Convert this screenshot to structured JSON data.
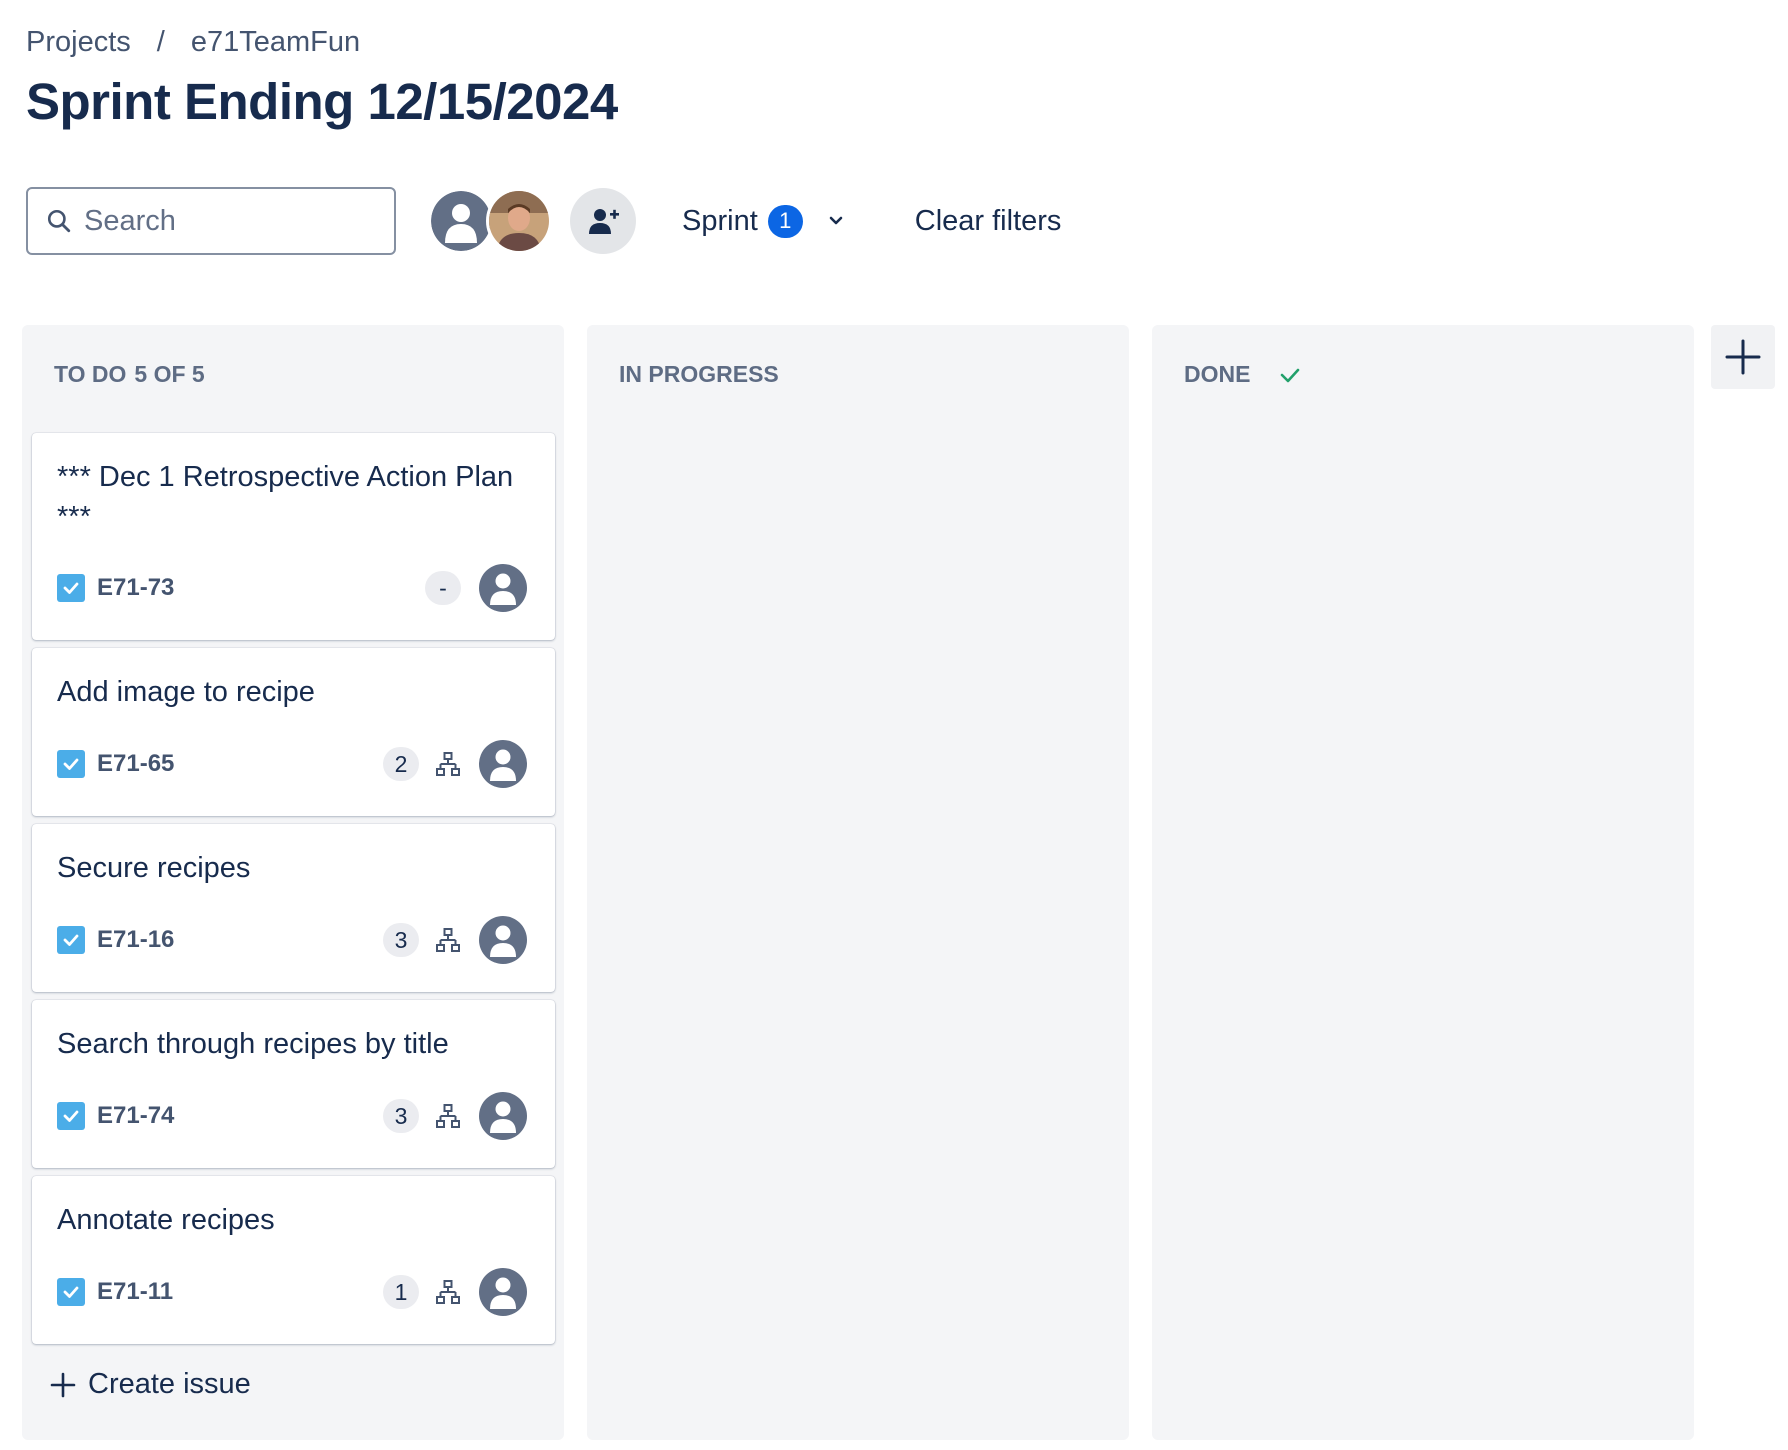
{
  "breadcrumb": {
    "projects": "Projects",
    "separator": "/",
    "project": "e71TeamFun"
  },
  "page_title": "Sprint Ending 12/15/2024",
  "toolbar": {
    "search_placeholder": "Search",
    "sprint_label": "Sprint",
    "sprint_count": "1",
    "clear_filters": "Clear filters"
  },
  "columns": {
    "todo": {
      "title": "TO DO",
      "count": "5 OF 5"
    },
    "in_progress": {
      "title": "IN PROGRESS"
    },
    "done": {
      "title": "DONE"
    }
  },
  "cards": [
    {
      "title": "*** Dec 1 Retrospective Action Plan ***",
      "key": "E71-73",
      "points": "-",
      "has_children": false
    },
    {
      "title": "Add image to recipe",
      "key": "E71-65",
      "points": "2",
      "has_children": true
    },
    {
      "title": "Secure recipes",
      "key": "E71-16",
      "points": "3",
      "has_children": true
    },
    {
      "title": "Search through recipes by title",
      "key": "E71-74",
      "points": "3",
      "has_children": true
    },
    {
      "title": "Annotate recipes",
      "key": "E71-11",
      "points": "1",
      "has_children": true
    }
  ],
  "create_issue": "Create issue",
  "colors": {
    "accent": "#0c66e4",
    "task_icon": "#4bade8",
    "done_check": "#22a06b",
    "column_bg": "#f4f5f7"
  },
  "icons": [
    "search-icon",
    "user-avatar-icon",
    "add-people-icon",
    "chevron-down-icon",
    "check-icon",
    "plus-icon",
    "task-checkbox-icon",
    "child-issues-icon"
  ]
}
